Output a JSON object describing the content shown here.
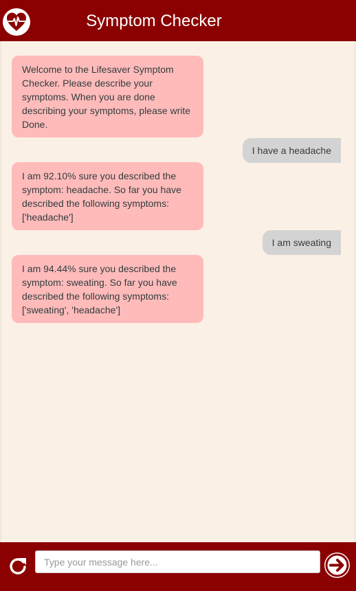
{
  "header": {
    "title": "Symptom Checker",
    "logo_icon": "heart-pulse-icon",
    "bg_color": "#8b0000"
  },
  "messages": [
    {
      "sender": "bot",
      "text": "Welcome to the Lifesaver Symptom Checker. Please describe your symptoms. When you are done describing your symptoms, please write Done."
    },
    {
      "sender": "user",
      "text": "I have a headache"
    },
    {
      "sender": "bot",
      "text": "I am 92.10% sure you described the symptom: headache. So far you have described the following symptoms: ['headache']"
    },
    {
      "sender": "user",
      "text": "I am sweating"
    },
    {
      "sender": "bot",
      "text": "I am 94.44% sure you described the symptom: sweating. So far you have described the following symptoms: ['sweating', 'headache']"
    }
  ],
  "footer": {
    "input_placeholder": "Type your message here...",
    "input_value": "",
    "reset_icon": "refresh-icon",
    "send_icon": "arrow-right-circle-icon"
  },
  "colors": {
    "bot_bubble": "#ffbaba",
    "user_bubble": "#d3d3d3",
    "chat_background": "#faf0e6"
  }
}
